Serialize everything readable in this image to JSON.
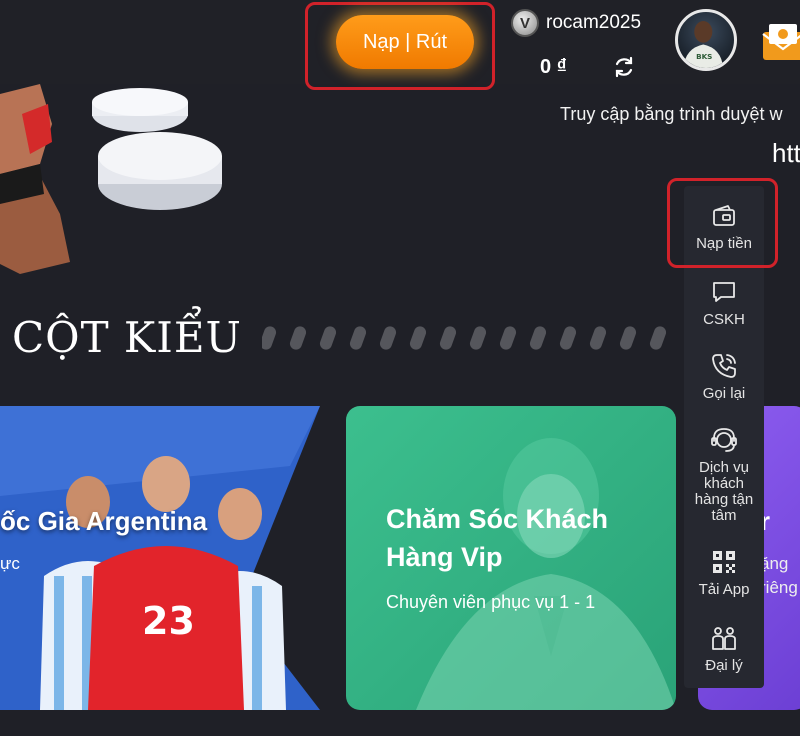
{
  "header": {
    "deposit_label": "Nạp | Rút",
    "vip_letter": "V",
    "username": "rocam2025",
    "balance": "0 ₫"
  },
  "hero": {
    "hint_text": "Truy cập bằng trình duyệt w",
    "hint_link": "htt"
  },
  "section": {
    "title": "CỘT KIỂU"
  },
  "cards": {
    "argentina": {
      "title": "ốc Gia Argentina",
      "subtitle": "ực",
      "jersey_number": "23"
    },
    "vip": {
      "title": "Chăm Sóc Khách Hàng Vip",
      "subtitle": "Chuyên viên phục vụ 1 - 1"
    },
    "purple": {
      "title": "ur",
      "sub1": "ặng",
      "sub2": "riêng"
    }
  },
  "sidebar": {
    "items": [
      {
        "label": "Nạp tiền",
        "icon": "wallet-icon"
      },
      {
        "label": "CSKH",
        "icon": "chat-icon"
      },
      {
        "label": "Gọi lại",
        "icon": "phone-icon"
      },
      {
        "label": "Dịch vụ khách hàng tận tâm",
        "icon": "headset-icon"
      },
      {
        "label": "Tải App",
        "icon": "qr-code-icon"
      },
      {
        "label": "Đại lý",
        "icon": "agent-icon"
      }
    ]
  },
  "colors": {
    "background": "#1f2027",
    "accent_orange": "#f07a00",
    "highlight_red": "#d1222a",
    "vip_green": "#3cbf8e",
    "purple": "#8d5df0"
  }
}
